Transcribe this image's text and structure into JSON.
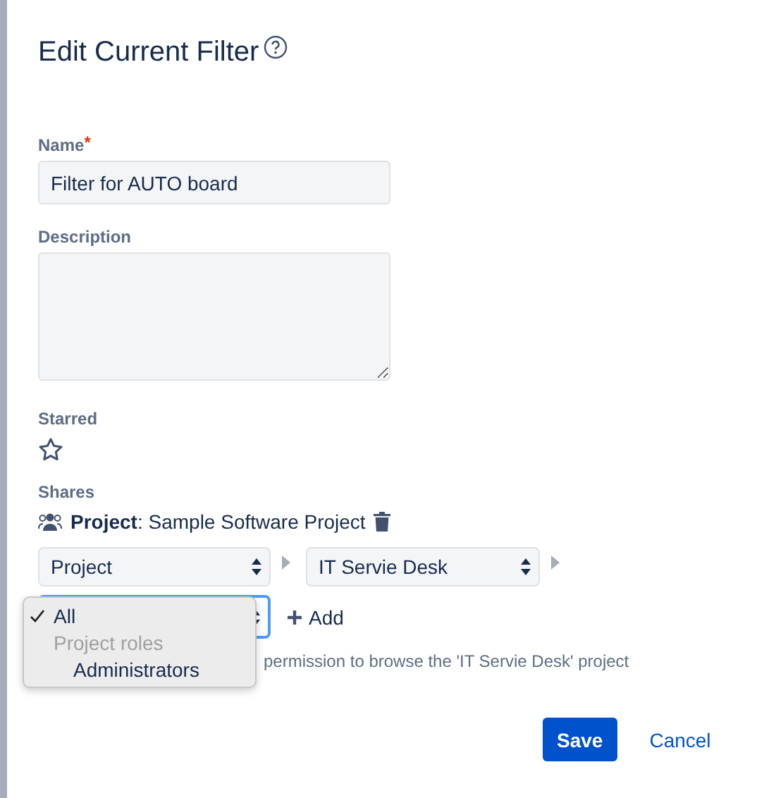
{
  "dialog": {
    "title": "Edit Current Filter",
    "fields": {
      "name": {
        "label": "Name",
        "required_mark": "*",
        "value": "Filter for AUTO board"
      },
      "description": {
        "label": "Description"
      },
      "starred": {
        "label": "Starred",
        "checked": false
      }
    },
    "shares": {
      "label": "Shares",
      "existing": {
        "text": "**Project**: Sample Software Project"
      },
      "selects": [
        {
          "value": "Project"
        },
        {
          "value": "IT Servie Desk"
        }
      ],
      "role_select": {
        "focused": true,
        "menu": [
          {
            "kind": "option",
            "label": "All",
            "selected": true
          },
          {
            "kind": "group",
            "label": "Project roles"
          },
          {
            "kind": "option",
            "label": "Administrators",
            "selected": false
          }
        ]
      },
      "add_label": "Add",
      "hint": "permission to browse the 'IT Servie Desk' project"
    },
    "buttons": [
      {
        "kind": "primary",
        "label": "Save"
      },
      {
        "kind": "link",
        "label": "Cancel"
      }
    ]
  }
}
